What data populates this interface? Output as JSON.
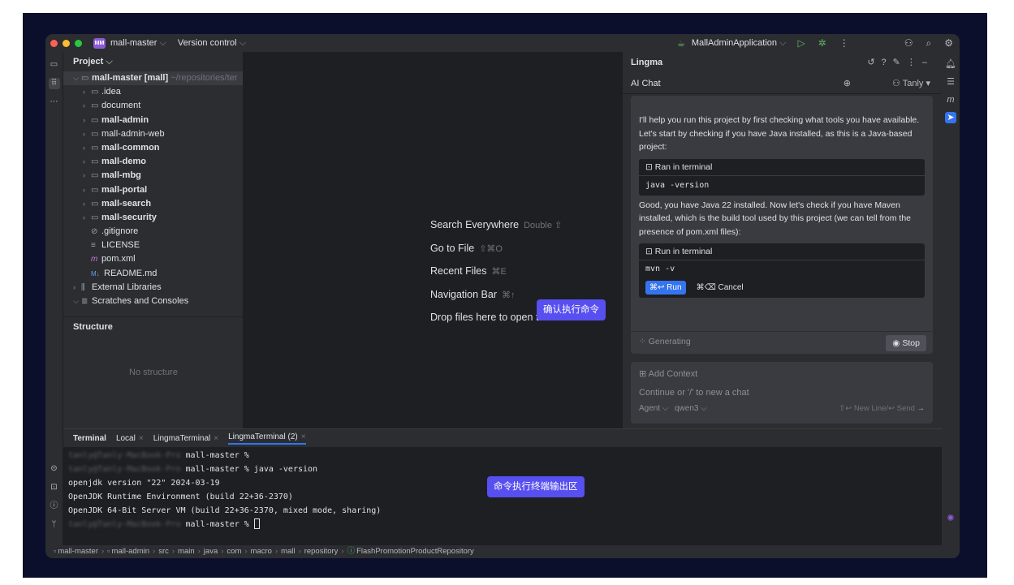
{
  "titlebar": {
    "project_badge": "MM",
    "project_name": "mall-master",
    "vcs": "Version control",
    "run_config": "MallAdminApplication",
    "traffic_colors": [
      "#ff5f57",
      "#febc2e",
      "#28c840"
    ]
  },
  "project_panel": {
    "title": "Project",
    "root": "mall-master [mall]",
    "root_path": "~/repositories/ter",
    "items": [
      {
        "name": ".idea",
        "bold": false
      },
      {
        "name": "document",
        "bold": false
      },
      {
        "name": "mall-admin",
        "bold": true
      },
      {
        "name": "mall-admin-web",
        "bold": false
      },
      {
        "name": "mall-common",
        "bold": true
      },
      {
        "name": "mall-demo",
        "bold": true
      },
      {
        "name": "mall-mbg",
        "bold": true
      },
      {
        "name": "mall-portal",
        "bold": true
      },
      {
        "name": "mall-search",
        "bold": true
      },
      {
        "name": "mall-security",
        "bold": true
      }
    ],
    "files": [
      ".gitignore",
      "LICENSE",
      "pom.xml",
      "README.md"
    ],
    "external": "External Libraries",
    "scratches": "Scratches and Consoles"
  },
  "structure": {
    "title": "Structure",
    "empty": "No structure"
  },
  "editor": {
    "hints": [
      {
        "label": "Search Everywhere",
        "key": "Double ⇧"
      },
      {
        "label": "Go to File",
        "key": "⇧⌘O"
      },
      {
        "label": "Recent Files",
        "key": "⌘E"
      },
      {
        "label": "Navigation Bar",
        "key": "⌘↑"
      },
      {
        "label": "Drop files here to open them",
        "key": ""
      }
    ],
    "tip_confirm": "确认执行命令",
    "tip_terminal": "命令执行终端输出区"
  },
  "lingma": {
    "title": "Lingma",
    "tab": "AI Chat",
    "user": "Tanly",
    "msg1": "I'll help you run this project by first checking what tools you have available. Let's start by checking if you have Java installed, as this is a Java-based project:",
    "card1_header": "Ran in terminal",
    "card1_cmd": "java -version",
    "msg2": "Good, you have Java 22 installed. Now let's check if you have Maven installed, which is the build tool used by this project (we can tell from the presence of pom.xml files):",
    "card2_header": "Run in terminal",
    "card2_cmd": "mvn -v",
    "run_label": "⌘↩ Run",
    "cancel_label": "⌘⌫ Cancel",
    "generating": "Generating",
    "stop": "Stop",
    "add_context": "Add Context",
    "input_placeholder": "Continue or '/' to new a chat",
    "mode": "Agent",
    "model": "qwen3",
    "send_hint": "⇧↩ New Line/↩ Send"
  },
  "terminal": {
    "tabs": [
      {
        "label": "Terminal",
        "closable": false
      },
      {
        "label": "Local",
        "closable": true
      },
      {
        "label": "LingmaTerminal",
        "closable": true
      },
      {
        "label": "LingmaTerminal (2)",
        "closable": true
      }
    ],
    "prompt_blur": "tanly@Tanly-MacBook-Pro",
    "lines": [
      {
        "blur": true,
        "text": " mall-master %"
      },
      {
        "blur": true,
        "text": " mall-master % java -version"
      },
      {
        "blur": false,
        "text": "openjdk version \"22\" 2024-03-19"
      },
      {
        "blur": false,
        "text": "OpenJDK Runtime Environment (build 22+36-2370)"
      },
      {
        "blur": false,
        "text": "OpenJDK 64-Bit Server VM (build 22+36-2370, mixed mode, sharing)"
      },
      {
        "blur": true,
        "text": " mall-master % "
      }
    ]
  },
  "statusbar": {
    "crumbs": [
      "mall-master",
      "mall-admin",
      "src",
      "main",
      "java",
      "com",
      "macro",
      "mall",
      "repository",
      "FlashPromotionProductRepository"
    ]
  }
}
